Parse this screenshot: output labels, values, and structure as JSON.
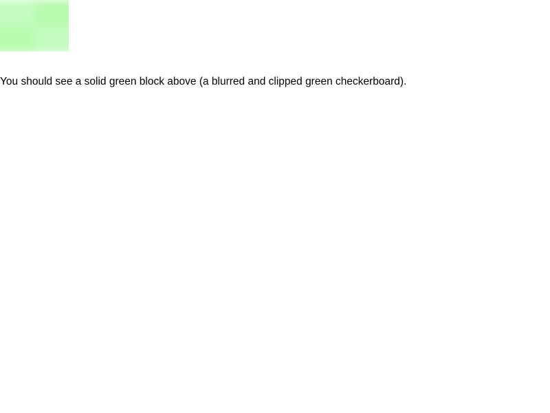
{
  "block": {
    "colors": {
      "light": "#c4fcc0",
      "dark": "#b8faae"
    }
  },
  "caption": {
    "text": "You should see a solid green block above (a blurred and clipped green checkerboard)."
  }
}
